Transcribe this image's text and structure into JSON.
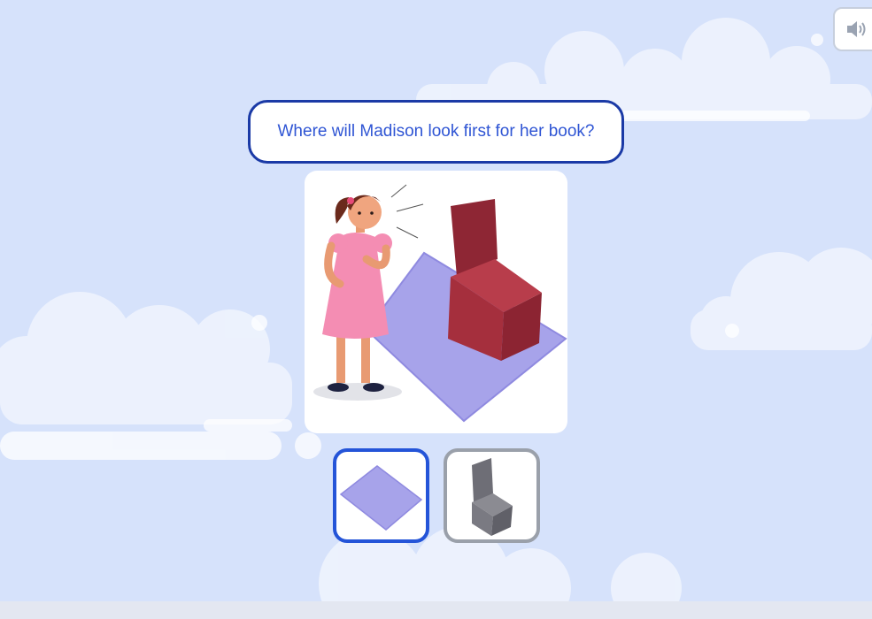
{
  "question": {
    "text": "Where will Madison look first for her book?"
  },
  "audio_button": {
    "icon": "speaker-icon"
  },
  "scene": {
    "description_icon": "girl-rug-chair-illustration"
  },
  "options": [
    {
      "name": "rug",
      "icon": "rug-icon",
      "selected": true
    },
    {
      "name": "chair",
      "icon": "chair-icon",
      "selected": false
    }
  ],
  "colors": {
    "background": "#d6e2fb",
    "question_border": "#1b3aa6",
    "question_text": "#2f55d4",
    "selected_border": "#2454d8",
    "unselected_border": "#9aa0aa"
  }
}
